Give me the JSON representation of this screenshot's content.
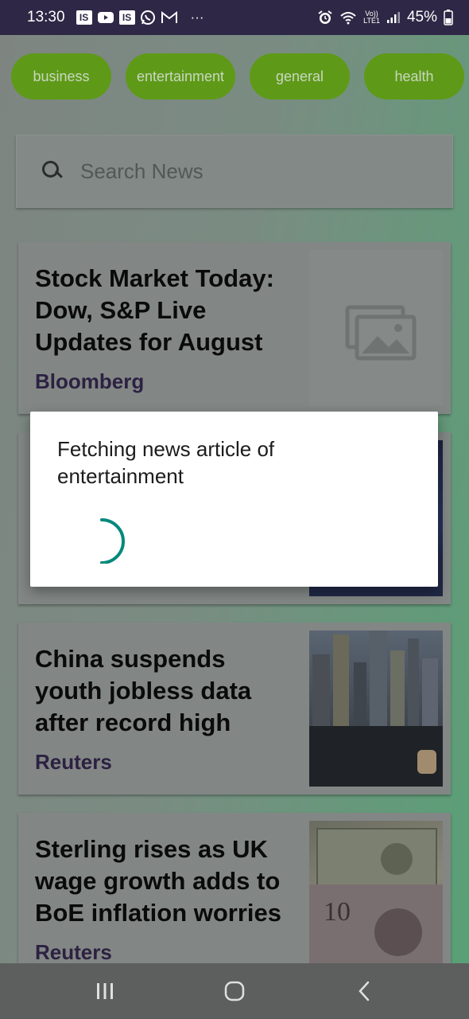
{
  "status_bar": {
    "time": "13:30",
    "battery": "45%",
    "network_top": "Vo))",
    "network_bottom": "LTE1",
    "icons": [
      "is-app-icon",
      "youtube-icon",
      "is-app-icon",
      "whatsapp-icon",
      "gmail-icon",
      "more-notifications-icon",
      "alarm-icon",
      "wifi-icon",
      "signal-icon",
      "battery-icon"
    ]
  },
  "categories": [
    "business",
    "entertainment",
    "general",
    "health"
  ],
  "search": {
    "placeholder": "Search News"
  },
  "articles": [
    {
      "title": "Stock Market Today: Dow, S&P Live Updates for August",
      "source": "Bloomberg",
      "image": "image-placeholder-icon"
    },
    {
      "title": "",
      "source": "",
      "image": "night-city-photo"
    },
    {
      "title": "China suspends youth jobless data after record high",
      "source": "Reuters",
      "image": "city-skyline-photo"
    },
    {
      "title": "Sterling rises as UK wage growth adds to BoE inflation worries",
      "source": "Reuters",
      "image": "banknotes-photo"
    }
  ],
  "dialog": {
    "message": "Fetching news article of entertainment"
  },
  "nav_bar": {
    "buttons": [
      "recent-apps-icon",
      "home-icon",
      "back-icon"
    ]
  },
  "colors": {
    "status_bar": "#2e2846",
    "chip": "#5e9a18",
    "spinner": "#00897b",
    "source_text": "#2d2142"
  }
}
